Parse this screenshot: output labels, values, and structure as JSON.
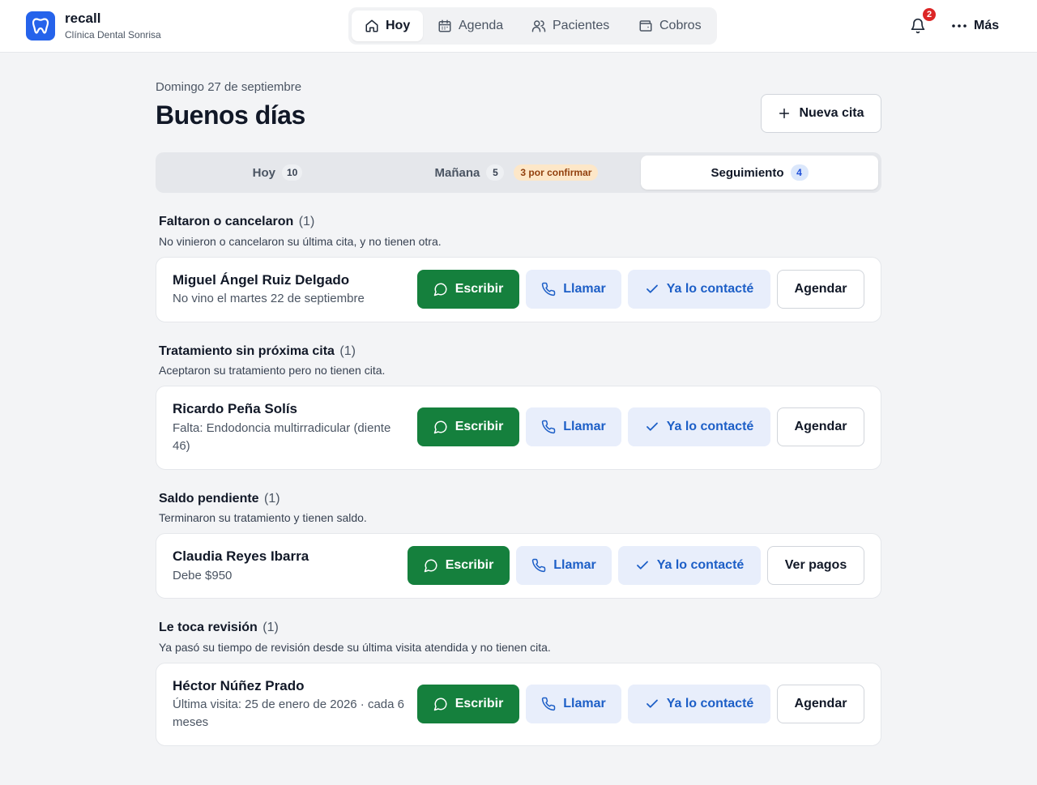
{
  "app": {
    "name": "recall",
    "clinic": "Clínica Dental Sonrisa"
  },
  "nav": [
    {
      "label": "Hoy",
      "icon": "home-icon"
    },
    {
      "label": "Agenda",
      "icon": "calendar-icon"
    },
    {
      "label": "Pacientes",
      "icon": "users-icon"
    },
    {
      "label": "Cobros",
      "icon": "wallet-icon"
    }
  ],
  "notifications": {
    "count": "2"
  },
  "more_label": "Más",
  "header": {
    "date": "Domingo 27 de septiembre",
    "greeting": "Buenos días",
    "new_appointment": "Nueva cita"
  },
  "tabs": [
    {
      "label": "Hoy",
      "count": "10"
    },
    {
      "label": "Mañana",
      "count": "5",
      "pending": "3 por confirmar"
    },
    {
      "label": "Seguimiento",
      "count": "4"
    }
  ],
  "actions": {
    "write": "Escribir",
    "call": "Llamar",
    "done": "Ya lo contacté",
    "schedule": "Agendar",
    "payments": "Ver pagos"
  },
  "sections": [
    {
      "title": "Faltaron o cancelaron",
      "count": "(1)",
      "description": "No vinieron o cancelaron su última cita, y no tienen otra.",
      "patient": {
        "name": "Miguel Ángel Ruiz Delgado",
        "info": "No vino el martes 22 de septiembre"
      }
    },
    {
      "title": "Tratamiento sin próxima cita",
      "count": "(1)",
      "description": "Aceptaron su tratamiento pero no tienen cita.",
      "patient": {
        "name": "Ricardo Peña Solís",
        "info": "Falta: Endodoncia multirradicular (diente 46)"
      }
    },
    {
      "title": "Saldo pendiente",
      "count": "(1)",
      "description": "Terminaron su tratamiento y tienen saldo.",
      "patient": {
        "name": "Claudia Reyes Ibarra",
        "info": "Debe $950"
      }
    },
    {
      "title": "Le toca revisión",
      "count": "(1)",
      "description": "Ya pasó su tiempo de revisión desde su última visita atendida y no tienen cita.",
      "patient": {
        "name": "Héctor Núñez Prado",
        "info": "Última visita: 25 de enero de 2026 · cada 6 meses"
      }
    }
  ],
  "colors": {
    "primary": "#2563eb",
    "write_button": "#15803d",
    "secondary_button_bg": "#e8eefb",
    "secondary_button_text": "#1d5fc7",
    "badge_alert": "#dc2626",
    "pending_badge_bg": "#fde7c8"
  }
}
